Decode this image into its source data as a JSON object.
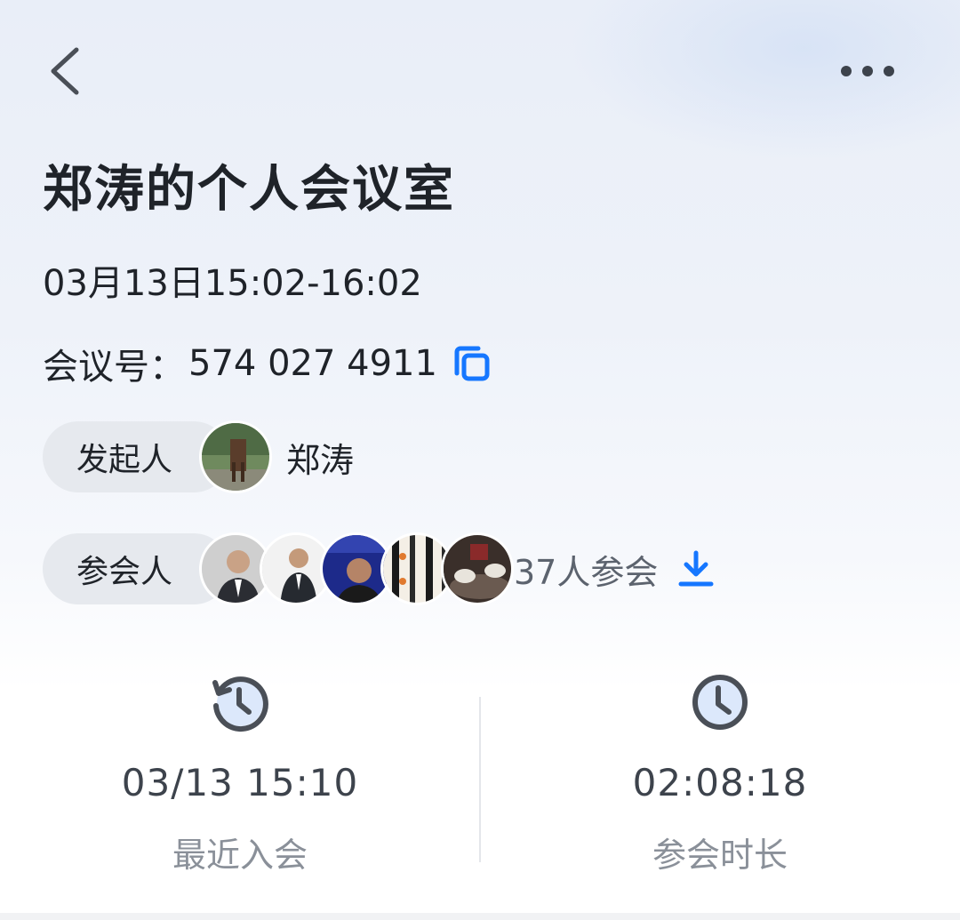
{
  "header": {
    "back_icon": "chevron-left-icon",
    "more_icon": "more-dots-icon"
  },
  "meeting": {
    "title": "郑涛的个人会议室",
    "time_range": "03月13日15:02-16:02",
    "id_label": "会议号：",
    "id_value": "574 027 4911",
    "copy_icon": "copy-icon"
  },
  "organizer": {
    "label": "发起人",
    "name": "郑涛"
  },
  "participants": {
    "label": "参会人",
    "count_text": "37人参会",
    "download_icon": "download-icon"
  },
  "stats": {
    "last_join": {
      "value": "03/13 15:10",
      "label": "最近入会",
      "icon": "history-clock-icon"
    },
    "duration": {
      "value": "02:08:18",
      "label": "参会时长",
      "icon": "clock-icon"
    }
  },
  "colors": {
    "accent": "#1677ff",
    "text_primary": "#1f2329",
    "text_secondary": "#8a9099",
    "pill_bg": "#e6e9ee"
  }
}
